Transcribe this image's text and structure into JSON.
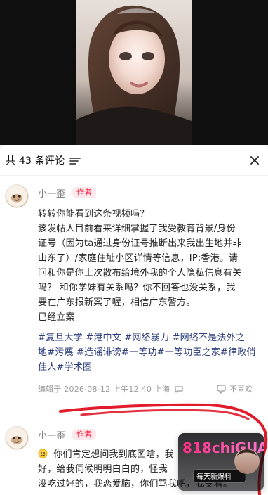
{
  "sheet": {
    "header_title": "共 43 条评论",
    "icons": {
      "sort": "sort-icon",
      "close": "close-icon"
    }
  },
  "comments": [
    {
      "user_name": "小一歪",
      "badge": "作者",
      "text_lines": [
        "转转你能看到这条视频吗？",
        "该发帖人目前看来详细掌握了我受教育背景/身份",
        "证号（因为ta通过身份证号推断出来我出生地并非",
        "山东了）/家庭住址小区详情等信息，IP:香港。请",
        "问和你是你上次散布给境外我的个人隐私信息有关",
        "吗？  和你学妹有关系吗？你不回答也没关系，我",
        "要在广东报新案了喔，相信广东警方。",
        "已经立案"
      ],
      "hashtag_lines": [
        "#复旦大学 #港中文 #网络暴力 #网络不是法外之",
        "地#污蔑 #造谣诽谤#一等功#一等功臣之家#律政俏",
        "佳人#学术圈"
      ],
      "meta": "编辑于 2026-08-12 上午12:40 上海",
      "dislike_label": "不喜欢"
    },
    {
      "user_name": "小一歪",
      "badge": "作者",
      "text_lines": [
        "你们肯定想问我到底图啥，我",
        "好，给我伺候明明白白的，怪我",
        "没吃过好的，我恋爱脑，你们骂我吧，我受着。"
      ]
    }
  ],
  "watermark": {
    "brand": "818chiGUA",
    "subtitle": "每天新爆料"
  },
  "colors": {
    "brand_red": "#ff2442",
    "hashtag_blue": "#2b3b7a",
    "annotation_red": "#e11b2a"
  }
}
